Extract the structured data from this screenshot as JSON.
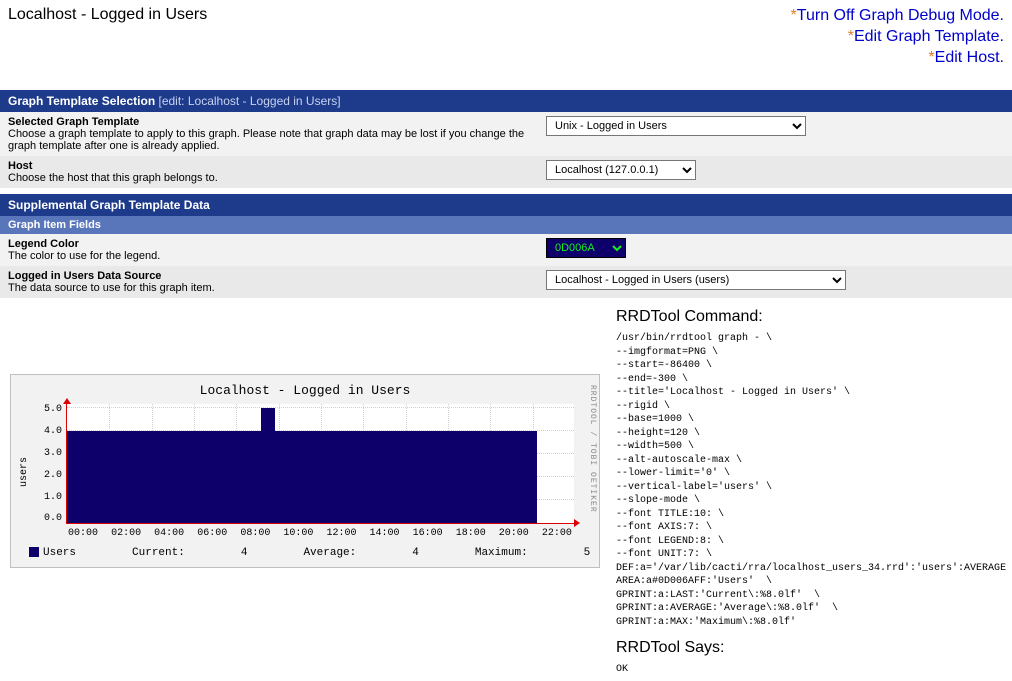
{
  "page_title": "Localhost - Logged in Users",
  "debug_links": {
    "turn_off": "Turn Off Graph Debug Mode.",
    "edit_template": "Edit Graph Template.",
    "edit_host": "Edit Host."
  },
  "section_template_selection": {
    "title": "Graph Template Selection",
    "edit_note": "[edit: Localhost - Logged in Users]"
  },
  "selected_template": {
    "label": "Selected Graph Template",
    "desc": "Choose a graph template to apply to this graph. Please note that graph data may be lost if you change the graph template after one is already applied.",
    "value": "Unix - Logged in Users"
  },
  "host": {
    "label": "Host",
    "desc": "Choose the host that this graph belongs to.",
    "value": "Localhost (127.0.0.1)"
  },
  "section_supplemental_title": "Supplemental Graph Template Data",
  "section_fields_title": "Graph Item Fields",
  "legend_color": {
    "label": "Legend Color",
    "desc": "The color to use for the legend.",
    "value": "0D006A"
  },
  "data_source": {
    "label": "Logged in Users Data Source",
    "desc": "The data source to use for this graph item.",
    "value": "Localhost - Logged in Users (users)"
  },
  "graph_preview": {
    "title": "Localhost - Logged in Users",
    "brand": "RRDTOOL / TOBI OETIKER",
    "ylabel": "users",
    "y_ticks": [
      "5.0",
      "4.0",
      "3.0",
      "2.0",
      "1.0",
      "0.0"
    ],
    "x_ticks": [
      "00:00",
      "02:00",
      "04:00",
      "06:00",
      "08:00",
      "10:00",
      "12:00",
      "14:00",
      "16:00",
      "18:00",
      "20:00",
      "22:00"
    ],
    "legend_name": "Users",
    "current_label": "Current:",
    "current_val": "4",
    "average_label": "Average:",
    "average_val": "4",
    "maximum_label": "Maximum:",
    "maximum_val": "5"
  },
  "rrdtool": {
    "cmd_title": "RRDTool Command:",
    "cmd": "/usr/bin/rrdtool graph - \\\n--imgformat=PNG \\\n--start=-86400 \\\n--end=-300 \\\n--title='Localhost - Logged in Users' \\\n--rigid \\\n--base=1000 \\\n--height=120 \\\n--width=500 \\\n--alt-autoscale-max \\\n--lower-limit='0' \\\n--vertical-label='users' \\\n--slope-mode \\\n--font TITLE:10: \\\n--font AXIS:7: \\\n--font LEGEND:8: \\\n--font UNIT:7: \\\nDEF:a='/var/lib/cacti/rra/localhost_users_34.rrd':'users':AVERAGE \\\nAREA:a#0D006AFF:'Users'  \\\nGPRINT:a:LAST:'Current\\:%8.0lf'  \\\nGPRINT:a:AVERAGE:'Average\\:%8.0lf'  \\\nGPRINT:a:MAX:'Maximum\\:%8.0lf'",
    "says_title": "RRDTool Says:",
    "says": "OK"
  },
  "chart_data": {
    "type": "area",
    "title": "Localhost - Logged in Users",
    "xlabel": "",
    "ylabel": "users",
    "ylim": [
      0,
      5.2
    ],
    "x_range_hours": [
      0,
      24
    ],
    "series": [
      {
        "name": "Users",
        "color": "#0D006A",
        "x": [
          0,
          1,
          2,
          3,
          4,
          5,
          6,
          7,
          8,
          9,
          9.2,
          9.8,
          10,
          11,
          12,
          13,
          14,
          15,
          16,
          17,
          18,
          19,
          20,
          21,
          22
        ],
        "y": [
          4,
          4,
          4,
          4,
          4,
          4,
          4,
          4,
          4,
          4,
          5,
          5,
          4,
          4,
          4,
          4,
          4,
          4,
          4,
          4,
          4,
          4,
          4,
          4,
          4
        ]
      }
    ],
    "summary": {
      "current": 4,
      "average": 4,
      "maximum": 5
    }
  }
}
